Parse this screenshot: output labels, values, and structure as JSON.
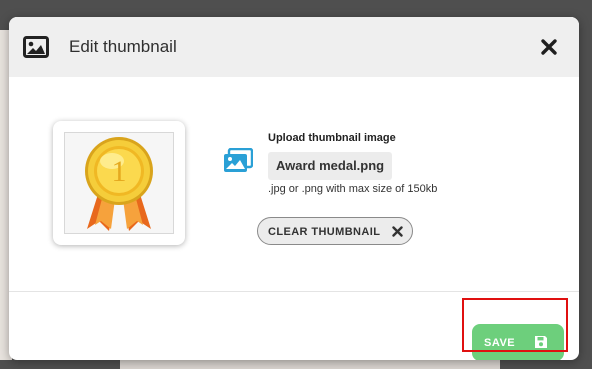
{
  "dialog": {
    "title": "Edit thumbnail",
    "header_icon": "image-icon",
    "close_icon": "close-icon"
  },
  "thumbnail": {
    "image_description": "gold medal with ribbon",
    "medal_text": "1"
  },
  "upload": {
    "icon": "images-icon",
    "label": "Upload thumbnail image",
    "file_name": "Award medal.png",
    "hint": ".jpg or .png with max size of 150kb"
  },
  "clear_button": {
    "label": "CLEAR THUMBNAIL",
    "icon": "close-icon"
  },
  "save_button": {
    "label": "SAVE",
    "icon": "floppy-disk-icon"
  },
  "colors": {
    "accent_blue": "#2aa0d6",
    "save_green": "#6dcf7c",
    "highlight_red": "#e01010"
  }
}
